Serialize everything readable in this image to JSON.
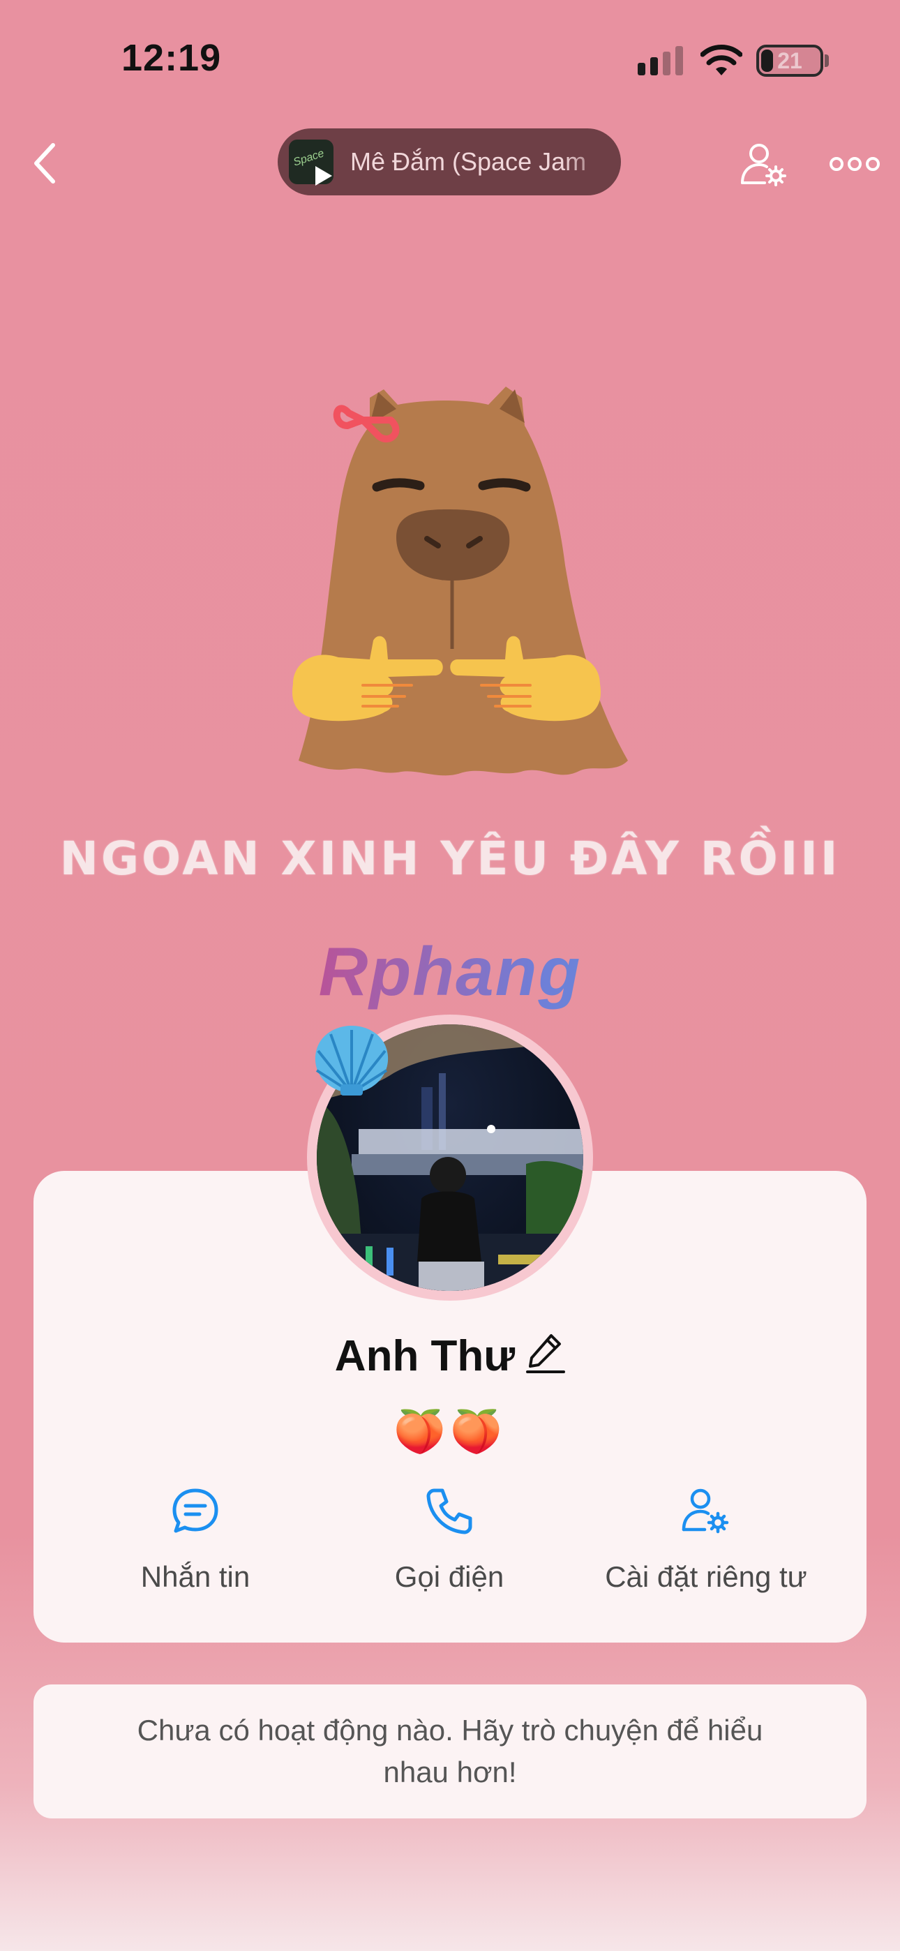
{
  "status_bar": {
    "time": "12:19",
    "battery_level": "21",
    "battery_fraction": 0.21
  },
  "header": {
    "back_icon": "chevron-left-icon",
    "now_playing": {
      "title": "Mê Đắm (Space Jam",
      "cover_text": "Space"
    },
    "user_settings_icon": "user-gear-icon",
    "more_icon": "more-dots-icon"
  },
  "cover": {
    "caption": "NGOAN XINH YÊU ĐÂY RỒIII",
    "watermark": "Rphang"
  },
  "profile": {
    "name": "Anh Thư",
    "bio": "🍑🍑",
    "badge": "shell-emoji"
  },
  "actions": [
    {
      "label": "Nhắn tin",
      "icon": "chat-bubble-icon"
    },
    {
      "label": "Gọi điện",
      "icon": "phone-icon"
    },
    {
      "label": "Cài đặt riêng tư",
      "icon": "user-gear-icon"
    }
  ],
  "activity": {
    "empty_text": "Chưa có hoạt động nào. Hãy trò chuyện để hiểu nhau hơn!"
  },
  "colors": {
    "background": "#e891a0",
    "accent_blue": "#1b8ff0",
    "card": "#fcf3f4",
    "music_pill": "#6e3f46"
  }
}
